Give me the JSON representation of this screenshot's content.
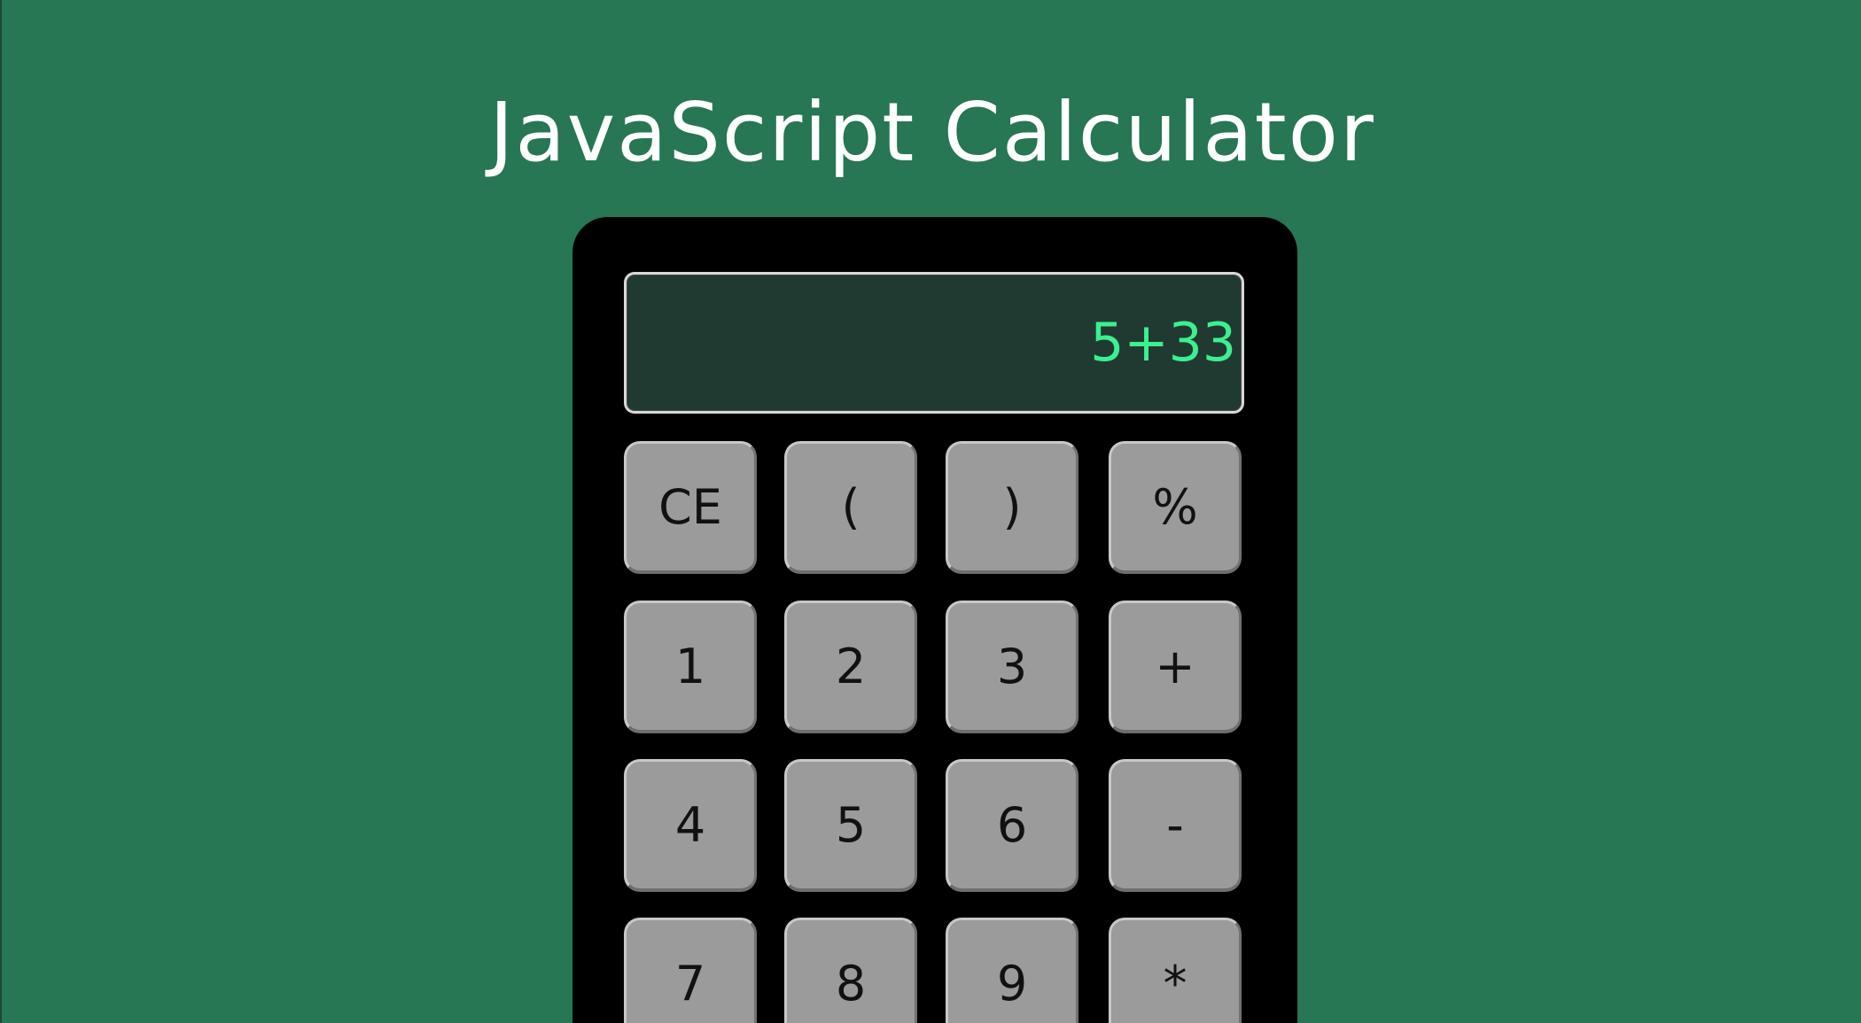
{
  "page": {
    "title": "JavaScript Calculator"
  },
  "calculator": {
    "display": "5+33",
    "keys": [
      [
        "CE",
        "(",
        ")",
        "%"
      ],
      [
        "1",
        "2",
        "3",
        "+"
      ],
      [
        "4",
        "5",
        "6",
        "-"
      ],
      [
        "7",
        "8",
        "9",
        "*"
      ]
    ]
  },
  "colors": {
    "background": "#277654",
    "calculator_body": "#000000",
    "display_bg": "#213a31",
    "display_text": "#3cf08f",
    "key_bg": "#9b9b9b"
  }
}
